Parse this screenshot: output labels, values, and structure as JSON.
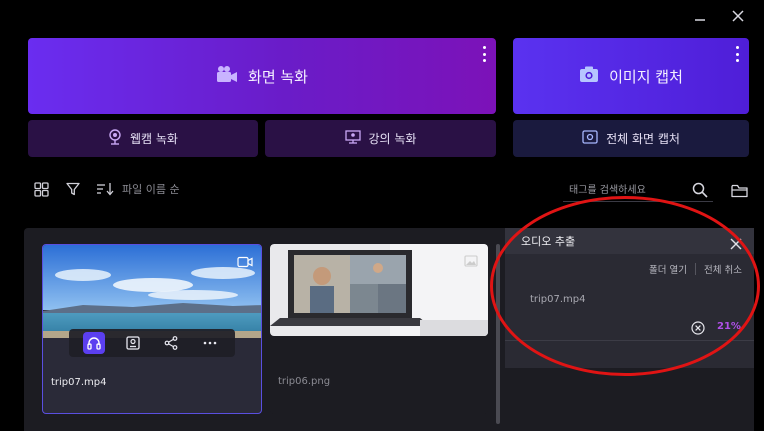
{
  "window": {
    "minimize_icon": "minimize-icon",
    "close_icon": "close-icon"
  },
  "top_buttons": {
    "screen_record": {
      "label": "화면 녹화",
      "icon": "video-camera-icon"
    },
    "image_capture": {
      "label": "이미지 캡처",
      "icon": "camera-icon"
    }
  },
  "sub_buttons": {
    "webcam": {
      "label": "웹캠 녹화",
      "icon": "webcam-icon"
    },
    "lecture": {
      "label": "강의 녹화",
      "icon": "presentation-icon"
    },
    "fullscreen": {
      "label": "전체 화면 캡처",
      "icon": "screen-capture-icon"
    }
  },
  "toolbar": {
    "sort_label": "파일 이름 순",
    "search_placeholder": "태그를 검색하세요"
  },
  "files": [
    {
      "name": "trip07.mp4",
      "type": "video",
      "selected": true
    },
    {
      "name": "trip06.png",
      "type": "image",
      "selected": false
    }
  ],
  "audio_panel": {
    "title": "오디오 추출",
    "open_folder": "폴더 열기",
    "cancel_all": "전체 취소",
    "job_name": "trip07.mp4",
    "progress": "21%"
  },
  "colors": {
    "accent": "#6a2df0",
    "progress_text": "#b050e8",
    "highlight": "#e01414"
  }
}
